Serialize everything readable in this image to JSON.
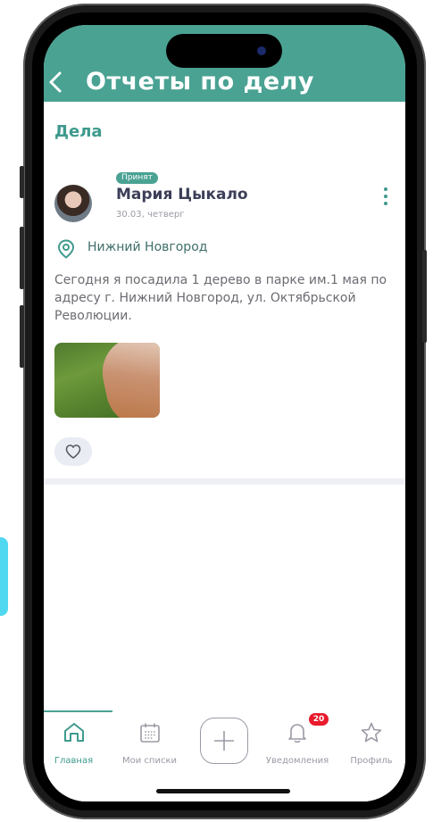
{
  "header": {
    "back_icon": "chevron-left-icon",
    "title": "Отчеты по делу"
  },
  "section": {
    "title": "Дела"
  },
  "post": {
    "status": "Принят",
    "author": "Мария Цыкало",
    "date": "30.03, четверг",
    "location": "Нижний Новгород",
    "text": "Сегодня я посадила 1 дерево в парке им.1 мая по адресу г. Нижний Новгород, ул. Октябрьской Революции.",
    "menu_icon": "more-vertical-icon",
    "like_icon": "heart-icon"
  },
  "tabbar": {
    "items": [
      {
        "label": "Главная",
        "icon": "home-icon",
        "active": true
      },
      {
        "label": "Мои списки",
        "icon": "calendar-icon",
        "active": false
      },
      {
        "label": "",
        "icon": "plus-icon",
        "active": false
      },
      {
        "label": "Уведомления",
        "icon": "bell-icon",
        "active": false
      },
      {
        "label": "Профиль",
        "icon": "star-icon",
        "active": false
      }
    ],
    "notifications_count": "20"
  },
  "colors": {
    "accent": "#4aa293",
    "badge": "#e81b2d",
    "text_dark": "#3c3f58",
    "muted": "#9a9aa5"
  }
}
